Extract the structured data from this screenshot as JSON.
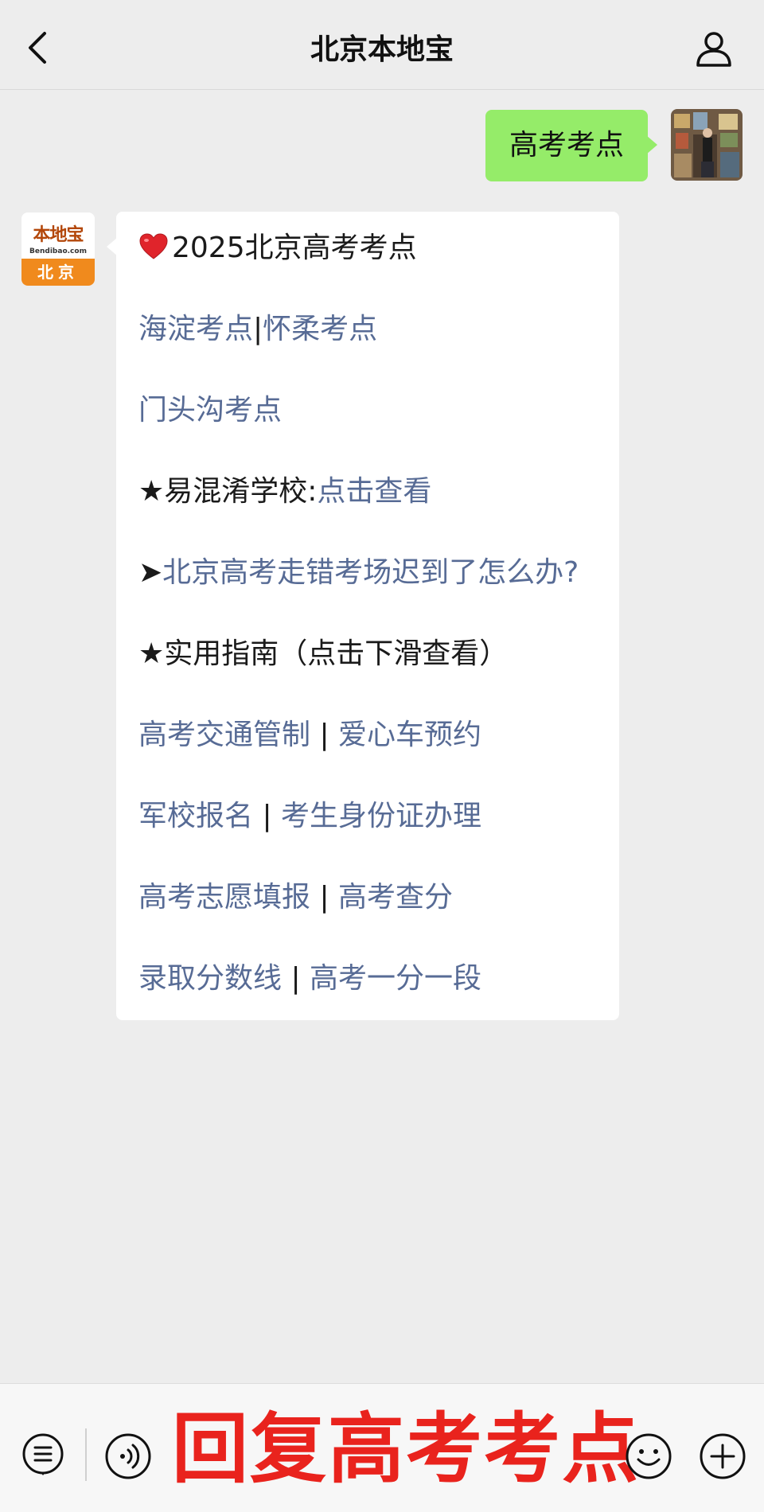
{
  "header": {
    "title": "北京本地宝",
    "back_icon": "chevron-left-icon",
    "profile_icon": "person-icon"
  },
  "messages": {
    "outgoing": {
      "text": "高考考点"
    },
    "incoming": {
      "avatar": {
        "logo_main": "本地宝",
        "logo_sub": "Bendibao.com",
        "logo_city": "北京"
      },
      "title": "2025北京高考考点",
      "title_icon": "heart-icon",
      "line_haidian": "海淀考点",
      "line_sep1": "|",
      "line_huairou": "怀柔考点",
      "line_mentougou": "门头沟考点",
      "confusing_prefix": "★易混淆学校:",
      "confusing_link": "点击查看",
      "late_prefix": "➤",
      "late_link": "北京高考走错考场迟到了怎么办?",
      "guide_heading": "★实用指南（点击下滑查看）",
      "guide_rows": [
        {
          "left": "高考交通管制",
          "sep": " | ",
          "right": "爱心车预约"
        },
        {
          "left": "军校报名",
          "sep": " | ",
          "right": "考生身份证办理"
        },
        {
          "left": "高考志愿填报",
          "sep": " | ",
          "right": "高考查分"
        },
        {
          "left": "录取分数线",
          "sep": " | ",
          "right": "高考一分一段"
        }
      ]
    }
  },
  "bottom_bar": {
    "overlay_text": "回复高考考点",
    "icons": [
      "menu-icon",
      "voice-icon",
      "emoji-icon",
      "plus-icon"
    ]
  },
  "colors": {
    "background": "#ededed",
    "outgoing_bubble": "#95ec69",
    "link": "#576b95",
    "overlay_red": "#e9231d",
    "brand_orange": "#f08a1d"
  }
}
